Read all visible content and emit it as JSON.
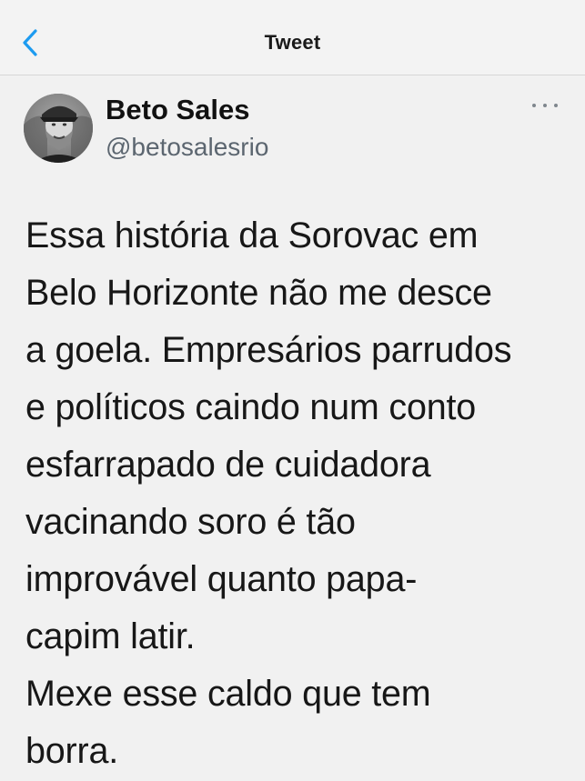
{
  "header": {
    "title": "Tweet"
  },
  "author": {
    "name": "Beto Sales",
    "handle": "@betosalesrio"
  },
  "tweet": {
    "lines": [
      "Essa história da Sorovac em",
      "Belo Horizonte não me desce",
      "a goela. Empresários parrudos",
      "e políticos caindo num conto",
      "esfarrapado de cuidadora",
      "vacinando soro é tão",
      "improvável quanto papa-",
      "capim latir.",
      "Mexe esse caldo que tem",
      "borra."
    ]
  },
  "icons": {
    "back": "chevron-left-icon",
    "more": "more-horizontal-icon",
    "avatar": "avatar-photo"
  },
  "colors": {
    "accent": "#1d9bf0",
    "background": "#f1f1f1",
    "handle_gray": "#5c6670",
    "divider": "#d6d6d6"
  }
}
